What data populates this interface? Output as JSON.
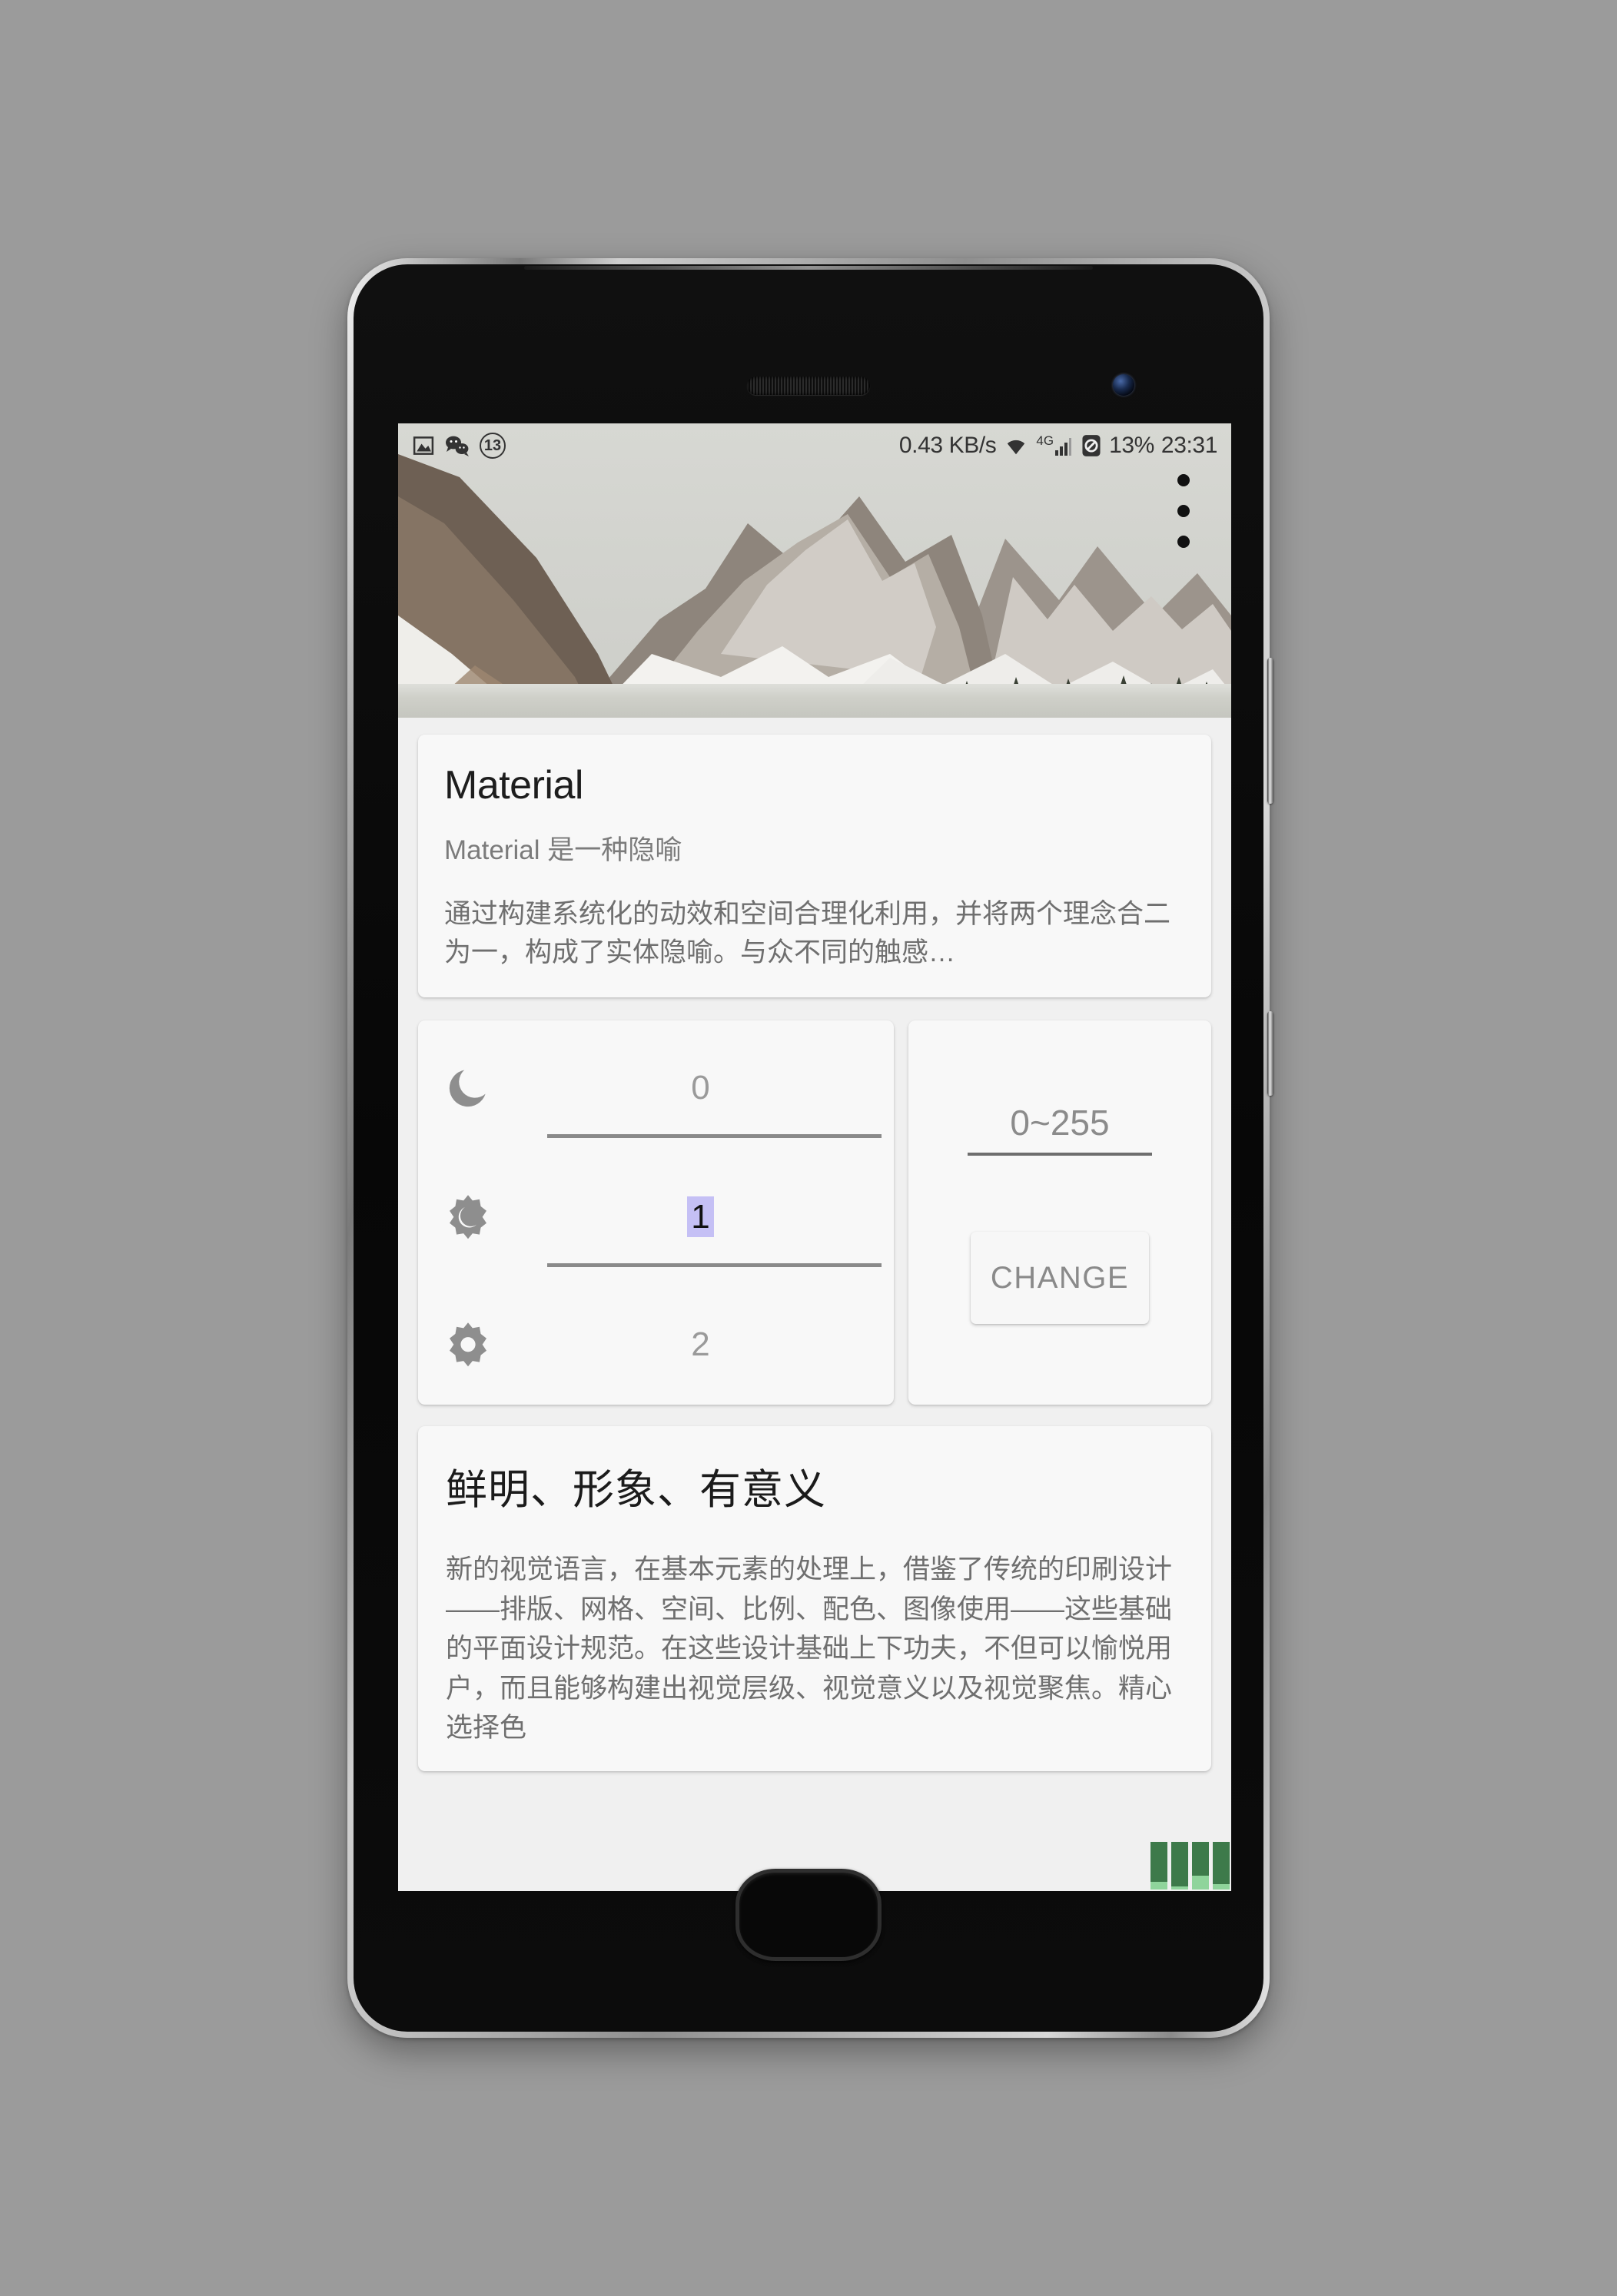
{
  "status_bar": {
    "left_icons": [
      "screenshot-icon",
      "wechat-icon"
    ],
    "notification_count": "13",
    "network_speed": "0.43 KB/s",
    "wifi": "wifi-icon",
    "mobile_network": "4G",
    "signal": "signal-bars-icon",
    "sim": "sim-no-icon",
    "battery_percent": "13%",
    "clock": "23:31"
  },
  "hero": {
    "image_alt": "snow-capped-mountain-lake-photo",
    "overflow_menu_icon": "more-vert-icon"
  },
  "material_card": {
    "title": "Material",
    "subtitle": "Material 是一种隐喻",
    "body": "通过构建系统化的动效和空间合理化利用，并将两个理念合二为一，构成了实体隐喻。与众不同的触感…"
  },
  "picker_card": {
    "rows": [
      {
        "icon": "moon-icon",
        "value": "0",
        "selected": false
      },
      {
        "icon": "brightness-medium-icon",
        "value": "1",
        "selected": true
      },
      {
        "icon": "brightness-high-icon",
        "value": "2",
        "selected": false
      }
    ]
  },
  "change_card": {
    "input_placeholder": "0~255",
    "input_value": "",
    "button_label": "CHANGE"
  },
  "vivid_card": {
    "title": "鲜明、形象、有意义",
    "body": "新的视觉语言，在基本元素的处理上，借鉴了传统的印刷设计——排版、网格、空间、比例、配色、图像使用——这些基础的平面设计规范。在这些设计基础上下功夫，不但可以愉悦用户，而且能够构建出视觉层级、视觉意义以及视觉聚焦。精心选择色"
  },
  "perf_overlay": {
    "label": "gpu-profiling-bars",
    "bars": [
      {
        "dark": 52,
        "light": 10
      },
      {
        "dark": 58,
        "light": 4
      },
      {
        "dark": 44,
        "light": 18
      },
      {
        "dark": 55,
        "light": 7
      }
    ]
  },
  "colors": {
    "screen_bg": "#f0f0f0",
    "card_bg": "#f8f8f8",
    "accent_selection": "#c5c0f5",
    "perf_dark": "#3d7a4a",
    "perf_light": "#8fd49b"
  }
}
